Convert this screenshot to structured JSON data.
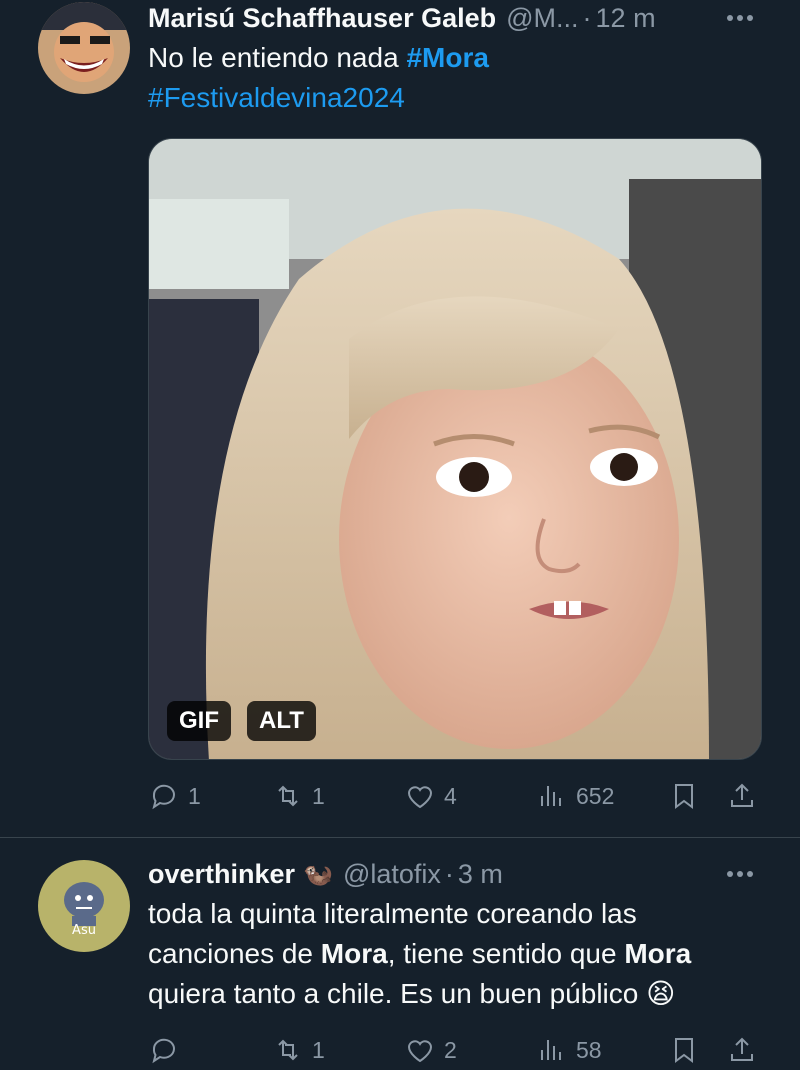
{
  "tweets": [
    {
      "name": "Marisú Schaffhauser Galeb",
      "handle": "@M...",
      "time": "12 m",
      "text_parts": [
        "No le entiendo nada ",
        "#Mora",
        "#Festivaldevina2024"
      ],
      "media": {
        "gif_label": "GIF",
        "alt_label": "ALT"
      },
      "stats": {
        "replies": "1",
        "retweets": "1",
        "likes": "4",
        "views": "652"
      }
    },
    {
      "name": "overthinker",
      "emoji": "🦦",
      "handle": "@latofix",
      "time": "3 m",
      "avatar_label": "Asu",
      "text_parts": [
        "toda la quinta literalmente coreando las canciones de ",
        "Mora",
        ", tiene sentido que ",
        "Mora",
        " quiera tanto a chile. Es un buen público ",
        "😫"
      ],
      "stats": {
        "replies": "",
        "retweets": "1",
        "likes": "2",
        "views": "58"
      }
    }
  ],
  "separator": "·",
  "colors": {
    "background": "#15202b",
    "accent": "#1d9bf0",
    "muted": "#8b98a5",
    "border": "#38444d"
  },
  "icons": [
    "more-icon",
    "reply-icon",
    "retweet-icon",
    "like-icon",
    "views-icon",
    "bookmark-icon",
    "share-icon"
  ]
}
